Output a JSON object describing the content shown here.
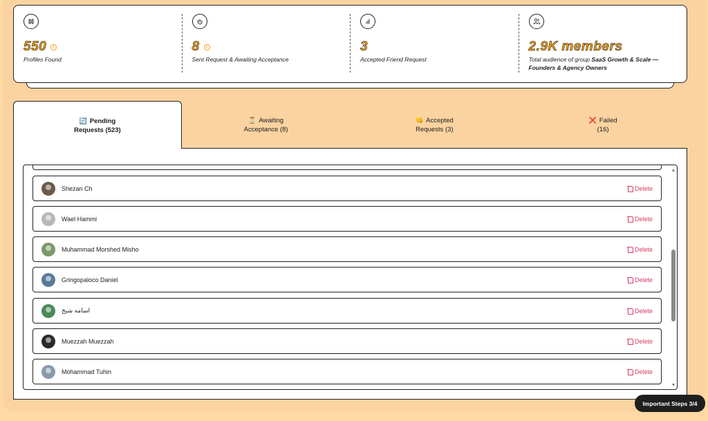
{
  "stats": [
    {
      "icon": "pause-icon",
      "icon_glyph": "⏸",
      "value": "550",
      "has_info": true,
      "label": "Profiles Found"
    },
    {
      "icon": "hand-wave-icon",
      "icon_glyph": "✋",
      "value": "8",
      "has_info": true,
      "label": "Sent Request & Awaiting Acceptance"
    },
    {
      "icon": "bar-chart-icon",
      "icon_glyph": "📊",
      "value": "3",
      "has_info": false,
      "label": "Accepted Friend Request"
    },
    {
      "icon": "users-icon",
      "icon_glyph": "👥",
      "value": "2.9K members",
      "has_info": false,
      "label_prefix": "Total audience of group ",
      "label_bold": "SaaS Growth & Scale — Founders & Agency Owners"
    }
  ],
  "tabs": [
    {
      "emoji": "🔄",
      "line1": "Pending",
      "line2": "Requests (523)",
      "active": true
    },
    {
      "emoji": "⏳",
      "line1": "Awaiting",
      "line2": "Acceptance (8)",
      "active": false
    },
    {
      "emoji": "👊",
      "line1": "Accepted",
      "line2": "Requests (3)",
      "active": false
    },
    {
      "emoji": "❌",
      "line1": "Failed",
      "line2": "(16)",
      "active": false
    }
  ],
  "rows": [
    {
      "name": "Shezan Ch",
      "avatar_color": "#6b5a48"
    },
    {
      "name": "Wael Hammi",
      "avatar_color": "#b8b8b8"
    },
    {
      "name": "Muhammad Morshed Misho",
      "avatar_color": "#7a9a6a"
    },
    {
      "name": "Gringopaloco Daniel",
      "avatar_color": "#5a7a9a"
    },
    {
      "name": "اسامه شیخ",
      "avatar_color": "#4a8a5a"
    },
    {
      "name": "Muezzah Muezzah",
      "avatar_color": "#2a2a2a"
    },
    {
      "name": "Mohammad Tuhin",
      "avatar_color": "#8a9aaa"
    }
  ],
  "delete_label": "Delete",
  "steps_badge": "Important Steps 3/4"
}
